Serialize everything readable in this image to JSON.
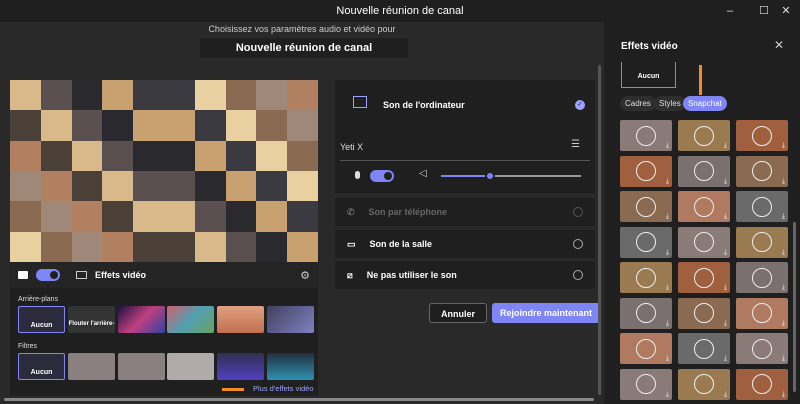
{
  "window": {
    "title": "Nouvelle réunion de canal",
    "minimize": "–",
    "maximize": "☐",
    "close": "✕"
  },
  "header": {
    "subtitle": "Choisissez vos paramètres audio et vidéo pour",
    "meeting_title": "Nouvelle réunion de canal"
  },
  "video_bar": {
    "camera_on": true,
    "effects_label": "Effets vidéo"
  },
  "effects": {
    "backgrounds_label": "Arrière-plans",
    "none_label": "Aucun",
    "blur_label": "Flouter l'arrière-",
    "filters_label": "Filtres",
    "more_link": "Plus d'effets vidéo"
  },
  "audio": {
    "computer_label": "Son de l'ordinateur",
    "device": "Yeti X",
    "mic_on": true,
    "volume_percent": 35,
    "phone_label": "Son par téléphone",
    "room_label": "Son de la salle",
    "none_label": "Ne pas utiliser le son"
  },
  "buttons": {
    "cancel": "Annuler",
    "join": "Rejoindre maintenant"
  },
  "side_panel": {
    "title": "Effets vidéo",
    "none_label": "Aucun",
    "tabs": [
      "Cadres",
      "Styles",
      "Snapchat"
    ],
    "active_tab": "Snapchat"
  },
  "colors": {
    "accent": "#7f85f5",
    "annotation_arrow": "#f28c28"
  }
}
